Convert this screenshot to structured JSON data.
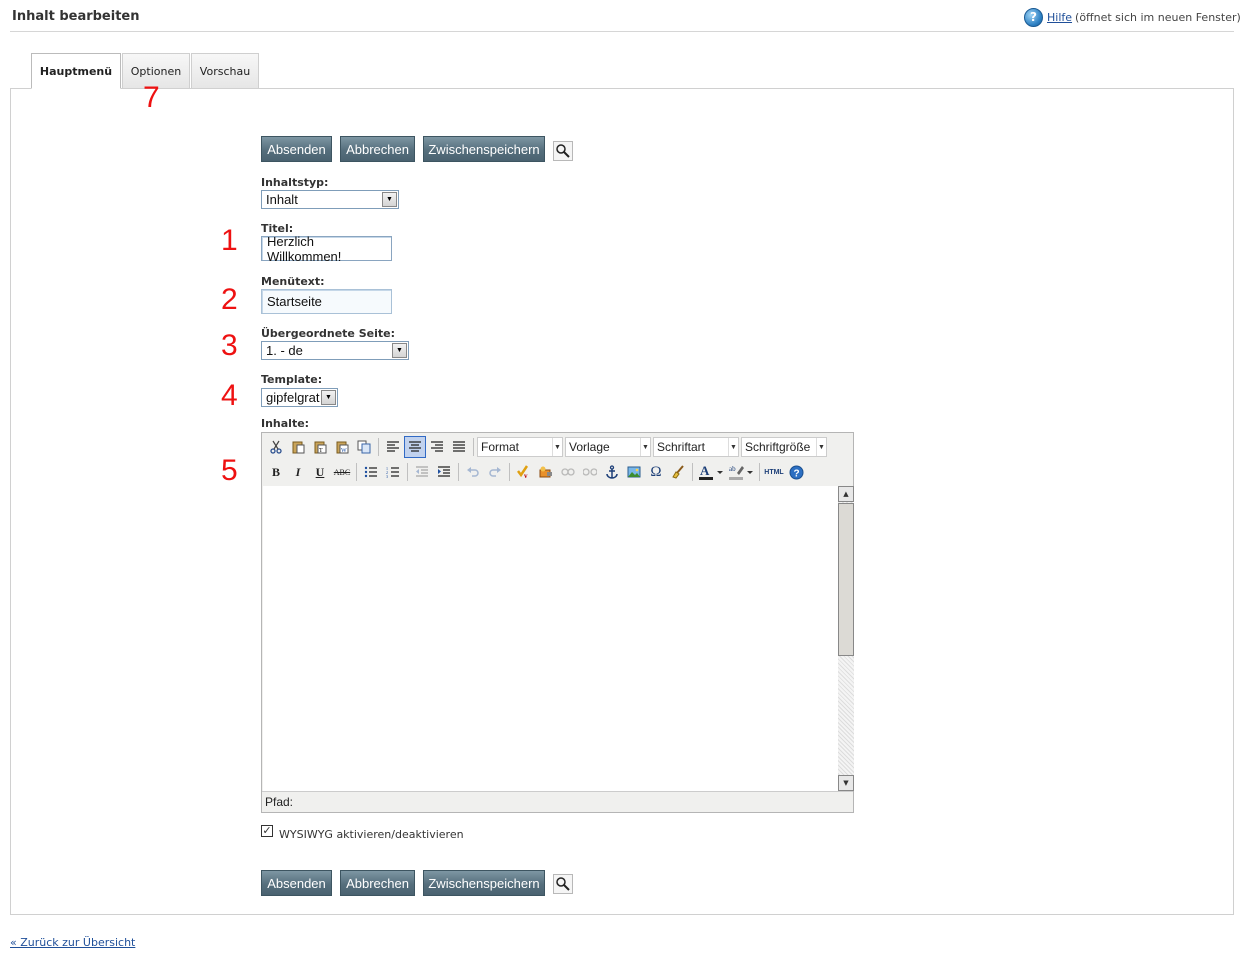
{
  "header": {
    "title": "Inhalt bearbeiten",
    "help_link": "Hilfe",
    "help_note": "(öffnet sich im neuen Fenster)"
  },
  "tabs": [
    {
      "label": "Hauptmenü",
      "active": true
    },
    {
      "label": "Optionen",
      "active": false
    },
    {
      "label": "Vorschau",
      "active": false
    }
  ],
  "annotations": [
    "7",
    "1",
    "2",
    "3",
    "4",
    "5"
  ],
  "buttons": {
    "submit": "Absenden",
    "cancel": "Abbrechen",
    "save_draft": "Zwischenspeichern"
  },
  "form": {
    "content_type": {
      "label": "Inhaltstyp:",
      "value": "Inhalt"
    },
    "title": {
      "label": "Titel:",
      "value": "Herzlich Willkommen!"
    },
    "menu_text": {
      "label": "Menütext:",
      "value": "Startseite"
    },
    "parent_page": {
      "label": "Übergeordnete Seite:",
      "value": "1. - de"
    },
    "template": {
      "label": "Template:",
      "value": "gipfelgrat"
    },
    "contents": {
      "label": "Inhalte:"
    }
  },
  "editor": {
    "dropdowns": [
      "Format",
      "Vorlage",
      "Schriftart",
      "Schriftgröße"
    ],
    "status_path": "Pfad:",
    "toolbar_row1_icons": [
      "cut-icon",
      "paste-icon",
      "paste-text-icon",
      "paste-word-icon",
      "copy-icon",
      "align-left-icon",
      "align-center-icon",
      "align-right-icon",
      "align-justify-icon"
    ],
    "toolbar_row2_icons": [
      "bold-icon",
      "italic-icon",
      "underline-icon",
      "strikethrough-icon",
      "bullet-list-icon",
      "numbered-list-icon",
      "outdent-icon",
      "indent-icon",
      "undo-icon",
      "redo-icon",
      "spellcheck-icon",
      "insert-media-icon",
      "link-icon",
      "unlink-icon",
      "anchor-icon",
      "image-icon",
      "special-char-icon",
      "cleanup-icon",
      "text-color-icon",
      "highlight-color-icon",
      "html-source-icon",
      "help-icon"
    ]
  },
  "wysiwyg": {
    "label": "WYSIWYG aktivieren/deaktivieren",
    "checked": true
  },
  "footer": {
    "back_link": "« Zurück zur Übersicht"
  },
  "colors": {
    "button": "#566f7d",
    "annotation": "#ee1111",
    "link": "#1f4f99"
  }
}
